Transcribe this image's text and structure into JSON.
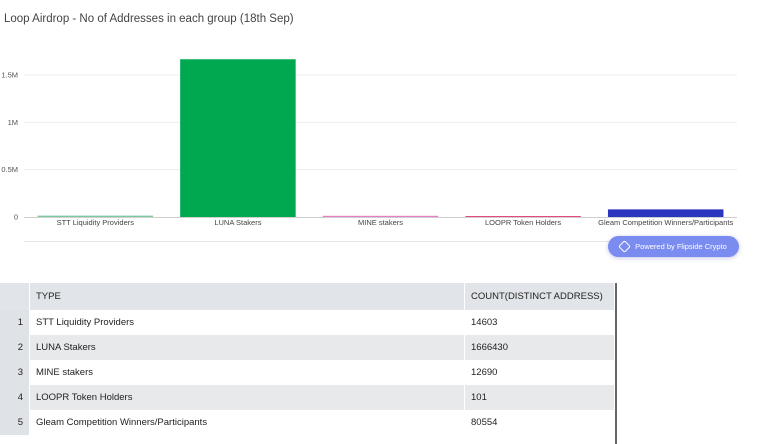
{
  "chart_data": {
    "type": "bar",
    "title": "Loop Airdrop - No of Addresses in each group (18th Sep)",
    "categories": [
      "STT Liquidity Providers",
      "LUNA Stakers",
      "MINE stakers",
      "LOOPR Token Holders",
      "Gleam Competition Winners/Participants"
    ],
    "values": [
      14603,
      1666430,
      12690,
      101,
      80554
    ],
    "colors": [
      "#7ec8a0",
      "#00a84f",
      "#e87ec4",
      "#e64a7c",
      "#2a35c0"
    ],
    "ylim": [
      0,
      1800000
    ],
    "yticks": [
      {
        "value": 0,
        "label": "0"
      },
      {
        "value": 500000,
        "label": "0.5M"
      },
      {
        "value": 1000000,
        "label": "1M"
      },
      {
        "value": 1500000,
        "label": "1.5M"
      }
    ],
    "grid": true,
    "legend": "none"
  },
  "badge": {
    "text": "Powered by Flipside Crypto",
    "icon": "flipside-logo-icon"
  },
  "table": {
    "columns": [
      "TYPE",
      "COUNT(DISTINCT ADDRESS)"
    ],
    "rows": [
      {
        "index": "1",
        "type": "STT Liquidity Providers",
        "count": "14603"
      },
      {
        "index": "2",
        "type": "LUNA Stakers",
        "count": "1666430"
      },
      {
        "index": "3",
        "type": "MINE stakers",
        "count": "12690"
      },
      {
        "index": "4",
        "type": "LOOPR Token Holders",
        "count": "101"
      },
      {
        "index": "5",
        "type": "Gleam Competition Winners/Participants",
        "count": "80554"
      }
    ]
  }
}
